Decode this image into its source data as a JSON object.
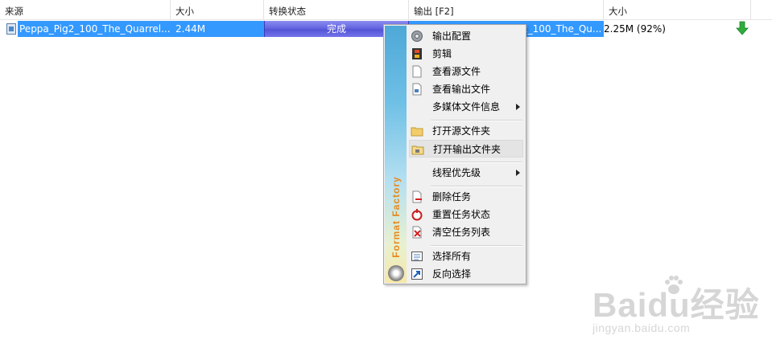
{
  "columns": {
    "source": "来源",
    "size": "大小",
    "status": "转换状态",
    "output": "输出 [F2]",
    "out_size": "大小"
  },
  "row": {
    "source_name": "Peppa_Pig2_100_The_Quarrel....",
    "size": "2.44M",
    "status": "完成",
    "output_name": "2_100_The_Qu...",
    "out_size": "2.25M  (92%)",
    "file_icon": "video-file-icon",
    "done_icon": "green-down-arrow-icon"
  },
  "menu": {
    "brand": "Format Factory",
    "items": [
      {
        "label": "输出配置",
        "icon": "gear-icon"
      },
      {
        "label": "剪辑",
        "icon": "film-clip-icon"
      },
      {
        "label": "查看源文件",
        "icon": "document-icon"
      },
      {
        "label": "查看输出文件",
        "icon": "output-document-icon"
      },
      {
        "label": "多媒体文件信息",
        "icon": "submenu-arrow-icon"
      },
      {
        "label": "打开源文件夹",
        "icon": "folder-icon"
      },
      {
        "label": "打开输出文件夹",
        "icon": "output-folder-icon"
      },
      {
        "label": "线程优先级",
        "icon": "submenu-arrow-icon"
      },
      {
        "label": "删除任务",
        "icon": "delete-document-icon"
      },
      {
        "label": "重置任务状态",
        "icon": "reset-icon"
      },
      {
        "label": "清空任务列表",
        "icon": "clear-list-icon"
      },
      {
        "label": "选择所有",
        "icon": "select-all-icon"
      },
      {
        "label": "反向选择",
        "icon": "invert-selection-icon"
      }
    ]
  },
  "watermark": {
    "brand": "Baidu经验",
    "url": "jingyan.baidu.com"
  },
  "colors": {
    "selection": "#3399ff",
    "status_bar": "#6566e0",
    "brand_text": "#e8891e"
  }
}
